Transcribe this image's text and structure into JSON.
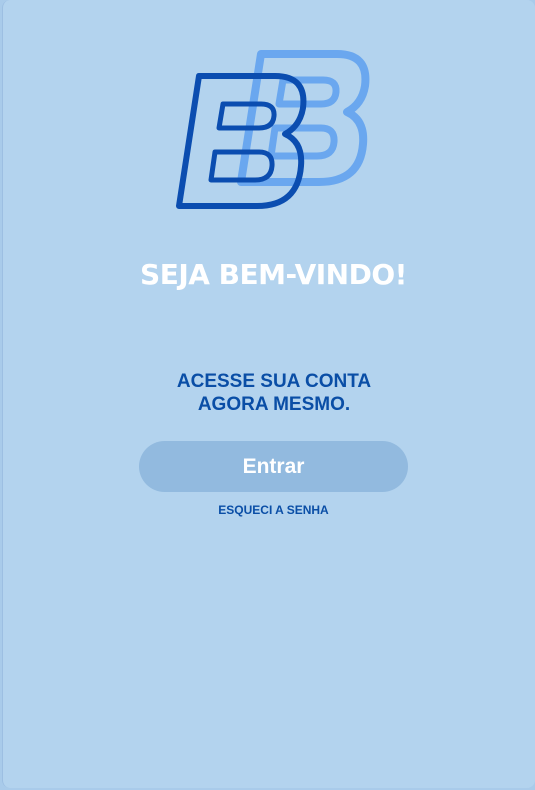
{
  "logo": {
    "icon": "bb-logo-icon",
    "colors": {
      "primary": "#0b4db0",
      "secondary": "#6aa7ef"
    }
  },
  "welcome": {
    "title": "SEJA BEM-VINDO!"
  },
  "access": {
    "line1": "ACESSE SUA CONTA",
    "line2": "AGORA MESMO."
  },
  "login": {
    "enter_label": "Entrar",
    "forgot_label": "ESQUECI A SENHA"
  },
  "colors": {
    "background": "#b3d3ee",
    "accent": "#0a4ea6",
    "button": "#92badf"
  }
}
